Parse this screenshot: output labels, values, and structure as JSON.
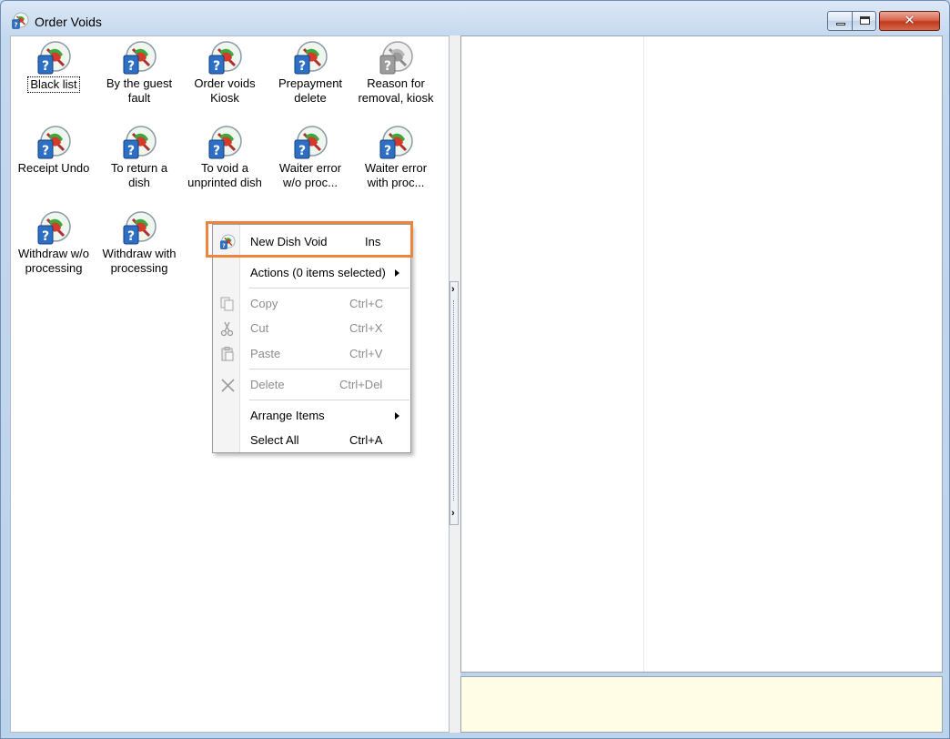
{
  "window": {
    "title": "Order Voids",
    "minimize_label": "",
    "maximize_label": "",
    "close_label": "✕"
  },
  "icons": [
    {
      "label1": "Black list",
      "label2": "",
      "disabled": false
    },
    {
      "label1": "By the guest",
      "label2": "fault",
      "disabled": false
    },
    {
      "label1": "Order voids",
      "label2": "Kiosk",
      "disabled": false
    },
    {
      "label1": "Prepayment",
      "label2": "delete",
      "disabled": false
    },
    {
      "label1": "Reason for",
      "label2": "removal, kiosk",
      "disabled": true
    },
    {
      "label1": "Receipt Undo",
      "label2": "",
      "disabled": false
    },
    {
      "label1": "To return a",
      "label2": "dish",
      "disabled": false
    },
    {
      "label1": "To void a",
      "label2": "unprinted dish",
      "disabled": false
    },
    {
      "label1": "Waiter error",
      "label2": "w/o proc...",
      "disabled": false
    },
    {
      "label1": "Waiter error",
      "label2": "with proc...",
      "disabled": false
    },
    {
      "label1": "Withdraw w/o",
      "label2": "processing",
      "disabled": false
    },
    {
      "label1": "Withdraw with",
      "label2": "processing",
      "disabled": false
    }
  ],
  "context_menu": {
    "new_dish_void": {
      "label": "New Dish Void",
      "shortcut": "Ins"
    },
    "actions": {
      "label": "Actions (0 items selected)"
    },
    "copy": {
      "label": "Copy",
      "shortcut": "Ctrl+C"
    },
    "cut": {
      "label": "Cut",
      "shortcut": "Ctrl+X"
    },
    "paste": {
      "label": "Paste",
      "shortcut": "Ctrl+V"
    },
    "delete": {
      "label": "Delete",
      "shortcut": "Ctrl+Del"
    },
    "arrange": {
      "label": "Arrange Items"
    },
    "select_all": {
      "label": "Select All",
      "shortcut": "Ctrl+A"
    }
  },
  "colors": {
    "highlight_box": "#ef8340",
    "note_pane_bg": "#fffde6"
  }
}
